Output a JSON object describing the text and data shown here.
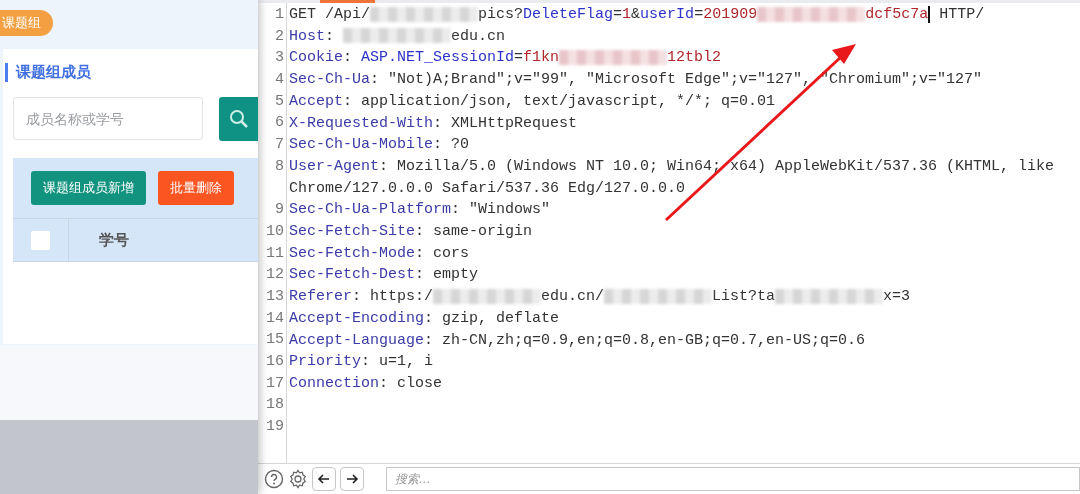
{
  "left_page": {
    "group_tag": "课题组",
    "section_title": "课题组成员",
    "search": {
      "placeholder": "成员名称或学号"
    },
    "buttons": [
      {
        "label": "课题组成员新增",
        "kind": "primary"
      },
      {
        "label": "批量删除",
        "kind": "danger"
      }
    ],
    "table": {
      "select_all": {
        "checked": false
      },
      "columns": [
        {
          "label": "学号"
        }
      ]
    }
  },
  "editor": {
    "lines": [
      {
        "number": "1",
        "segments": [
          {
            "kind": "text",
            "text": "GET /Api/"
          },
          {
            "kind": "redacted"
          },
          {
            "kind": "text",
            "text": "pics?"
          },
          {
            "kind": "param",
            "text": "DeleteFlag"
          },
          {
            "kind": "text",
            "text": "="
          },
          {
            "kind": "value",
            "text": "1"
          },
          {
            "kind": "text",
            "text": "&"
          },
          {
            "kind": "param",
            "text": "userId"
          },
          {
            "kind": "text",
            "text": "="
          },
          {
            "kind": "value",
            "text": "201909"
          },
          {
            "kind": "redacted-value"
          },
          {
            "kind": "value",
            "text": "dcf5c7a"
          },
          {
            "kind": "cursor"
          },
          {
            "kind": "text",
            "text": " HTTP/"
          }
        ]
      },
      {
        "number": "2",
        "segments": [
          {
            "kind": "key",
            "text": "Host"
          },
          {
            "kind": "text",
            "text": ": "
          },
          {
            "kind": "redacted"
          },
          {
            "kind": "text",
            "text": "edu.cn"
          }
        ]
      },
      {
        "number": "3",
        "segments": [
          {
            "kind": "key",
            "text": "Cookie"
          },
          {
            "kind": "text",
            "text": ": "
          },
          {
            "kind": "param",
            "text": "ASP.NET_SessionId"
          },
          {
            "kind": "text",
            "text": "="
          },
          {
            "kind": "value",
            "text": "f1kn"
          },
          {
            "kind": "redacted-value"
          },
          {
            "kind": "value",
            "text": "12tbl2"
          }
        ]
      },
      {
        "number": "4",
        "segments": [
          {
            "kind": "key",
            "text": "Sec-Ch-Ua"
          },
          {
            "kind": "text",
            "text": ": \"Not)A;Brand\";v=\"99\", \"Microsoft Edge\";v=\"127\", \"Chromium\";v=\"127\""
          }
        ]
      },
      {
        "number": "5",
        "segments": [
          {
            "kind": "key",
            "text": "Accept"
          },
          {
            "kind": "text",
            "text": ": application/json, text/javascript, */*; q=0.01"
          }
        ]
      },
      {
        "number": "6",
        "segments": [
          {
            "kind": "key",
            "text": "X-Requested-With"
          },
          {
            "kind": "text",
            "text": ": XMLHttpRequest"
          }
        ]
      },
      {
        "number": "7",
        "segments": [
          {
            "kind": "key",
            "text": "Sec-Ch-Ua-Mobile"
          },
          {
            "kind": "text",
            "text": ": ?0"
          }
        ]
      },
      {
        "number": "8",
        "segments": [
          {
            "kind": "key",
            "text": "User-Agent"
          },
          {
            "kind": "text",
            "text": ": Mozilla/5.0 (Windows NT 10.0; Win64; x64) AppleWebKit/537.36 (KHTML, like"
          }
        ],
        "continuation": "Chrome/127.0.0.0 Safari/537.36 Edg/127.0.0.0"
      },
      {
        "number": "9",
        "segments": [
          {
            "kind": "key",
            "text": "Sec-Ch-Ua-Platform"
          },
          {
            "kind": "text",
            "text": ": \"Windows\""
          }
        ]
      },
      {
        "number": "10",
        "segments": [
          {
            "kind": "key",
            "text": "Sec-Fetch-Site"
          },
          {
            "kind": "text",
            "text": ": same-origin"
          }
        ]
      },
      {
        "number": "11",
        "segments": [
          {
            "kind": "key",
            "text": "Sec-Fetch-Mode"
          },
          {
            "kind": "text",
            "text": ": cors"
          }
        ]
      },
      {
        "number": "12",
        "segments": [
          {
            "kind": "key",
            "text": "Sec-Fetch-Dest"
          },
          {
            "kind": "text",
            "text": ": empty"
          }
        ]
      },
      {
        "number": "13",
        "segments": [
          {
            "kind": "key",
            "text": "Referer"
          },
          {
            "kind": "text",
            "text": ": https:/"
          },
          {
            "kind": "redacted"
          },
          {
            "kind": "text",
            "text": "edu.cn/"
          },
          {
            "kind": "redacted"
          },
          {
            "kind": "text",
            "text": "List?ta"
          },
          {
            "kind": "redacted"
          },
          {
            "kind": "text",
            "text": "x=3"
          }
        ]
      },
      {
        "number": "14",
        "segments": [
          {
            "kind": "key",
            "text": "Accept-Encoding"
          },
          {
            "kind": "text",
            "text": ": gzip, deflate"
          }
        ]
      },
      {
        "number": "15",
        "segments": [
          {
            "kind": "key",
            "text": "Accept-Language"
          },
          {
            "kind": "text",
            "text": ": zh-CN,zh;q=0.9,en;q=0.8,en-GB;q=0.7,en-US;q=0.6"
          }
        ]
      },
      {
        "number": "16",
        "segments": [
          {
            "kind": "key",
            "text": "Priority"
          },
          {
            "kind": "text",
            "text": ": u=1, i"
          }
        ]
      },
      {
        "number": "17",
        "segments": [
          {
            "kind": "key",
            "text": "Connection"
          },
          {
            "kind": "text",
            "text": ": close"
          }
        ]
      },
      {
        "number": "18"
      },
      {
        "number": "19"
      }
    ],
    "search": {
      "placeholder": "搜索..."
    }
  }
}
